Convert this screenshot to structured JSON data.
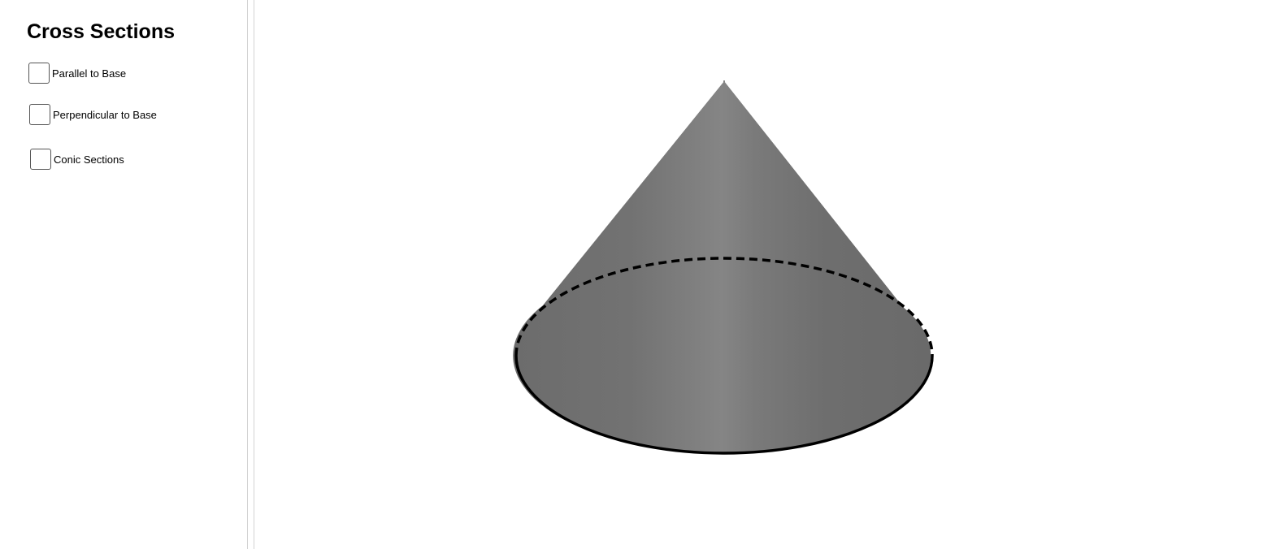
{
  "panel": {
    "title": "Cross Sections",
    "checkboxes": [
      {
        "label": "Parallel to Base",
        "checked": false
      },
      {
        "label": "Perpendicular to Base",
        "checked": false
      },
      {
        "label": "Conic Sections",
        "checked": false
      }
    ]
  },
  "scene": {
    "object": "cone",
    "surface_color": "#707070",
    "highlight_color": "#8a8a8a",
    "base_edge_color": "#000000",
    "hidden_edge_style": "dashed"
  }
}
